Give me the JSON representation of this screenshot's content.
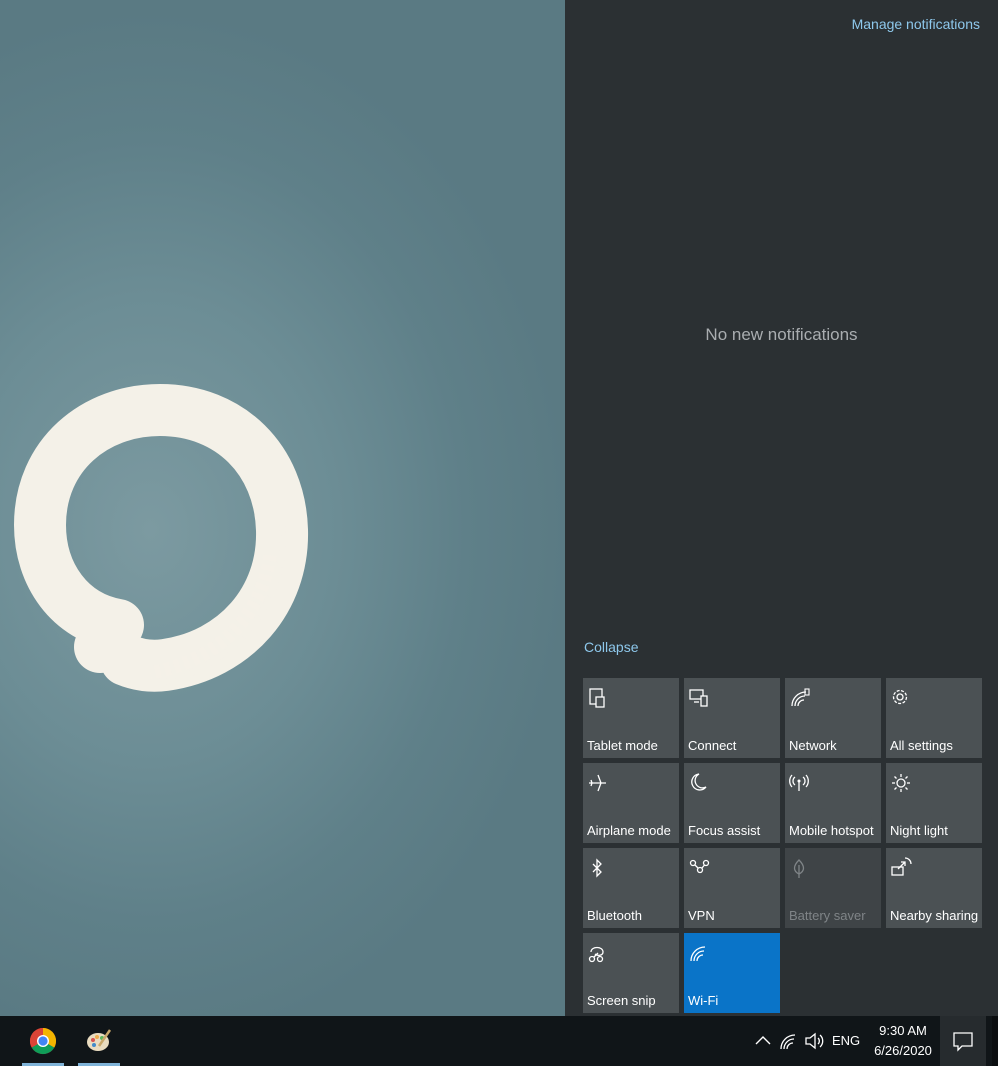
{
  "action_center": {
    "manage_notifications": "Manage notifications",
    "no_notifications": "No new notifications",
    "collapse": "Collapse",
    "tiles": [
      {
        "label": "Tablet mode",
        "icon": "tablet-mode-icon",
        "state": "off"
      },
      {
        "label": "Connect",
        "icon": "connect-icon",
        "state": "off"
      },
      {
        "label": "Network",
        "icon": "network-icon",
        "state": "off"
      },
      {
        "label": "All settings",
        "icon": "gear-icon",
        "state": "off"
      },
      {
        "label": "Airplane mode",
        "icon": "airplane-icon",
        "state": "off"
      },
      {
        "label": "Focus assist",
        "icon": "moon-icon",
        "state": "off"
      },
      {
        "label": "Mobile hotspot",
        "icon": "hotspot-icon",
        "state": "off"
      },
      {
        "label": "Night light",
        "icon": "sun-icon",
        "state": "off"
      },
      {
        "label": "Bluetooth",
        "icon": "bluetooth-icon",
        "state": "off"
      },
      {
        "label": "VPN",
        "icon": "vpn-icon",
        "state": "off"
      },
      {
        "label": "Battery saver",
        "icon": "leaf-icon",
        "state": "disabled"
      },
      {
        "label": "Nearby sharing",
        "icon": "share-icon",
        "state": "off"
      },
      {
        "label": "Screen snip",
        "icon": "snip-icon",
        "state": "off"
      },
      {
        "label": "Wi-Fi",
        "icon": "wifi-icon",
        "state": "on"
      }
    ]
  },
  "taskbar": {
    "apps": [
      "chrome-icon",
      "paint-icon"
    ],
    "language": "ENG",
    "time": "9:30 AM",
    "date": "6/26/2020"
  },
  "colors": {
    "panel": "#2b3033",
    "tile": "#4b5154",
    "tile_on": "#0a74c8",
    "link": "#8ec8ec",
    "taskbar": "#101518"
  }
}
